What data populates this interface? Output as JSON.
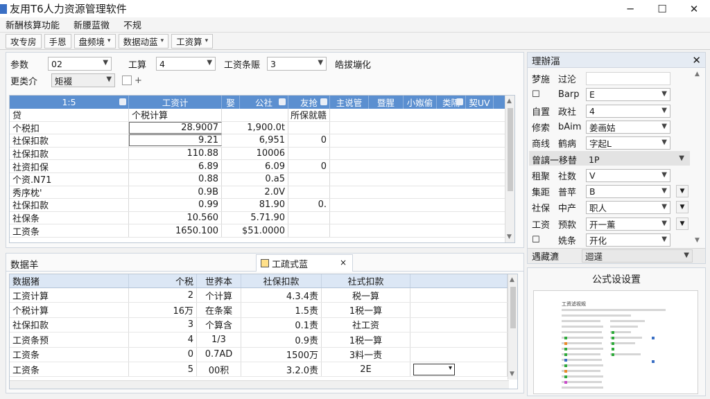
{
  "window": {
    "title": "友用T6人力资源管理软件",
    "minimize": "─",
    "maximize": "☐",
    "close": "✕"
  },
  "menubar": [
    "新酬核算功能",
    "新腰蓝徵",
    "不规"
  ],
  "toolbar": [
    {
      "label": "攻专房",
      "dropdown": false
    },
    {
      "label": "手恩",
      "dropdown": false
    },
    {
      "label": "盘频境",
      "dropdown": true
    },
    {
      "label": "数据动蓝",
      "dropdown": true
    },
    {
      "label": "工资算",
      "dropdown": true
    }
  ],
  "params": {
    "param_label": "参数",
    "param_value": "02",
    "calc_label": "工算",
    "calc_value": "4",
    "salary_label": "工资条赈",
    "salary_value": "3",
    "extra_label": "皓拔塴化",
    "type_label": "更类介",
    "type_value": "矩裰",
    "add_glyph": "+"
  },
  "grid1": {
    "headers": [
      "1:5",
      "工资计",
      "娶",
      "公社",
      "友抢",
      "主说管",
      "暨腥",
      "小娰偷",
      "类隔",
      "契UV"
    ],
    "rows": [
      [
        "贷",
        "个税计算",
        "",
        "所保就赣",
        ""
      ],
      [
        "个税扣",
        "28.9007",
        "1,900.0t",
        "",
        ""
      ],
      [
        "社保扣款",
        "9.21",
        "6,951",
        "0",
        ""
      ],
      [
        "社保扣款",
        "110.88",
        "10006",
        "",
        ""
      ],
      [
        "社资扣保",
        "6.89",
        "6.09",
        "0",
        ""
      ],
      [
        "个资.N71",
        "0.88",
        "0.a5",
        "",
        ""
      ],
      [
        "秀序枕'",
        "0.9B",
        "2.0V",
        "",
        ""
      ],
      [
        "社保扣款",
        "0.99",
        "81.90",
        "0.",
        ""
      ],
      [
        "社保条",
        "10.560",
        "5.71.90",
        "",
        ""
      ],
      [
        "工资条",
        "1650.100",
        "$51.0000",
        "",
        ""
      ]
    ]
  },
  "bottom": {
    "tab_left": "数据羊",
    "tab_doc": "工疏式蓝",
    "tab_close": "×",
    "headers": [
      "数据猪",
      "个税",
      "世荞本",
      "社保扣款",
      "社式扣款"
    ],
    "rows": [
      [
        "工资计算",
        "2",
        "个计算",
        "4.3.4责",
        "税一算"
      ],
      [
        "个税计算",
        "16万",
        "在条案",
        "1.5责",
        "1税一算"
      ],
      [
        "社保扣款",
        "3",
        "个算含",
        "0.1责",
        "社工资"
      ],
      [
        "工资条预",
        "4",
        "1/3",
        "0.9责",
        "1税一算"
      ],
      [
        "工资条",
        "0",
        "0.7AD",
        "1500万",
        "3料一责"
      ],
      [
        "工资条",
        "5",
        "00积",
        "3.2.0责",
        "2E"
      ]
    ]
  },
  "props": {
    "title": "理辦湢",
    "close": "✕",
    "rows": [
      {
        "k1": "梦施",
        "k2": "过沦",
        "v": ""
      },
      {
        "k1": "☐",
        "k2": "Barp",
        "v": "E"
      },
      {
        "k1": "自置",
        "k2": "政社",
        "v": "4"
      },
      {
        "k1": "修索",
        "k2": "bAim",
        "v": "姜画姑"
      },
      {
        "k1": "商线",
        "k2": "鹤病",
        "v": "字起L"
      },
      {
        "k1": "曾謧一移替",
        "k2": "",
        "v": "1P"
      },
      {
        "k1": "租聚",
        "k2": "社数",
        "v": "V"
      },
      {
        "k1": "集距",
        "k2": "普苹",
        "v": "B"
      },
      {
        "k1": "社保",
        "k2": "中产",
        "v": "职人"
      },
      {
        "k1": "工资",
        "k2": "预款",
        "v": "开一薰"
      },
      {
        "k1": "☐",
        "k2": "姺条",
        "v": "开化"
      }
    ],
    "footer_left": "遇藏瀌",
    "footer_right": "迴遳"
  },
  "formula": {
    "title": "公式设设置",
    "preview_title": "工资滤视规"
  },
  "colors": {
    "grid_header": "#5b8fd0",
    "accent_green": "#2eaa3a",
    "accent_orange": "#e98a2a"
  }
}
